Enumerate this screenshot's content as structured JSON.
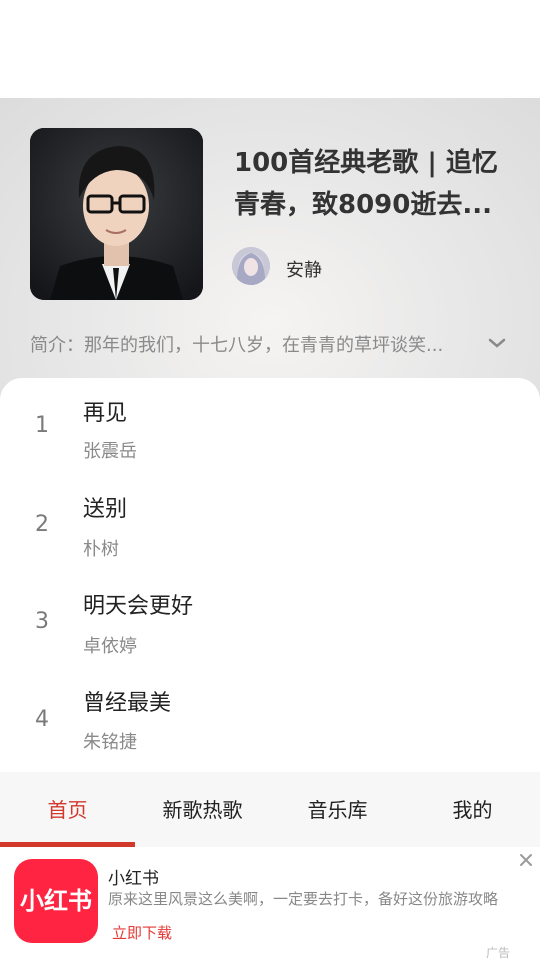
{
  "playlist": {
    "title": "100首经典老歌 | 追忆青春，致8090逝去...",
    "creator": "安静",
    "intro": "简介：那年的我们，十七八岁，在青青的草坪谈笑..."
  },
  "songs": [
    {
      "num": "1",
      "name": "再见",
      "artist": "张震岳"
    },
    {
      "num": "2",
      "name": "送别",
      "artist": "朴树"
    },
    {
      "num": "3",
      "name": "明天会更好",
      "artist": "卓依婷"
    },
    {
      "num": "4",
      "name": "曾经最美",
      "artist": "朱铭捷"
    }
  ],
  "tabs": [
    "首页",
    "新歌热歌",
    "音乐库",
    "我的"
  ],
  "active_tab": "首页",
  "ad": {
    "logo_text": "小红书",
    "title": "小红书",
    "description": "原来这里风景这么美啊，一定要去打卡，备好这份旅游攻略",
    "cta": "立即下载",
    "tag": "广告"
  },
  "colors": {
    "accent": "#d2392c",
    "ad_brand": "#ff2442"
  },
  "icons": {
    "intro_expand": "chevron-down-icon",
    "ad_close": "close-icon"
  }
}
